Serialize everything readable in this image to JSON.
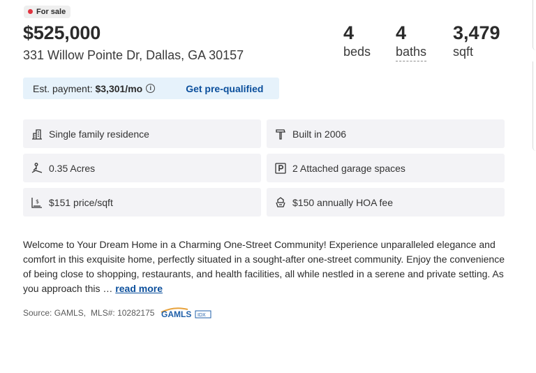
{
  "status": {
    "label": "For sale"
  },
  "listing": {
    "price": "$525,000",
    "address": "331 Willow Pointe Dr, Dallas, GA 30157"
  },
  "stats": [
    {
      "value": "4",
      "label": "beds"
    },
    {
      "value": "4",
      "label": "baths"
    },
    {
      "value": "3,479",
      "label": "sqft"
    }
  ],
  "payment": {
    "prefix": "Est. payment: ",
    "amount": "$3,301/mo",
    "cta": "Get pre-qualified"
  },
  "facts": [
    {
      "icon": "building-icon",
      "text": "Single family residence"
    },
    {
      "icon": "hammer-icon",
      "text": "Built in 2006"
    },
    {
      "icon": "acres-icon",
      "text": "0.35 Acres"
    },
    {
      "icon": "parking-icon",
      "text": "2 Attached garage spaces"
    },
    {
      "icon": "price-per-sqft-icon",
      "text": "$151 price/sqft"
    },
    {
      "icon": "hoa-icon",
      "text": "$150 annually HOA fee"
    }
  ],
  "description": {
    "text": "Welcome to Your Dream Home in a Charming One-Street Community! Experience unparalleled elegance and comfort in this exquisite home, perfectly situated in a sought-after one-street community. Enjoy the convenience of being close to shopping, restaurants, and health facilities, all while nestled in a serene and private setting. As you approach this … ",
    "read_more": "read more"
  },
  "source": {
    "source_text": "Source: GAMLS,",
    "mls_text": "MLS#: 10282175",
    "logo_text": "GAMLS",
    "logo_badge": "IDX"
  },
  "colors": {
    "accent_blue": "#0b4f9c",
    "status_red": "#e0333f",
    "payment_bg": "#e6f2fb",
    "fact_bg": "#f3f3f6"
  }
}
